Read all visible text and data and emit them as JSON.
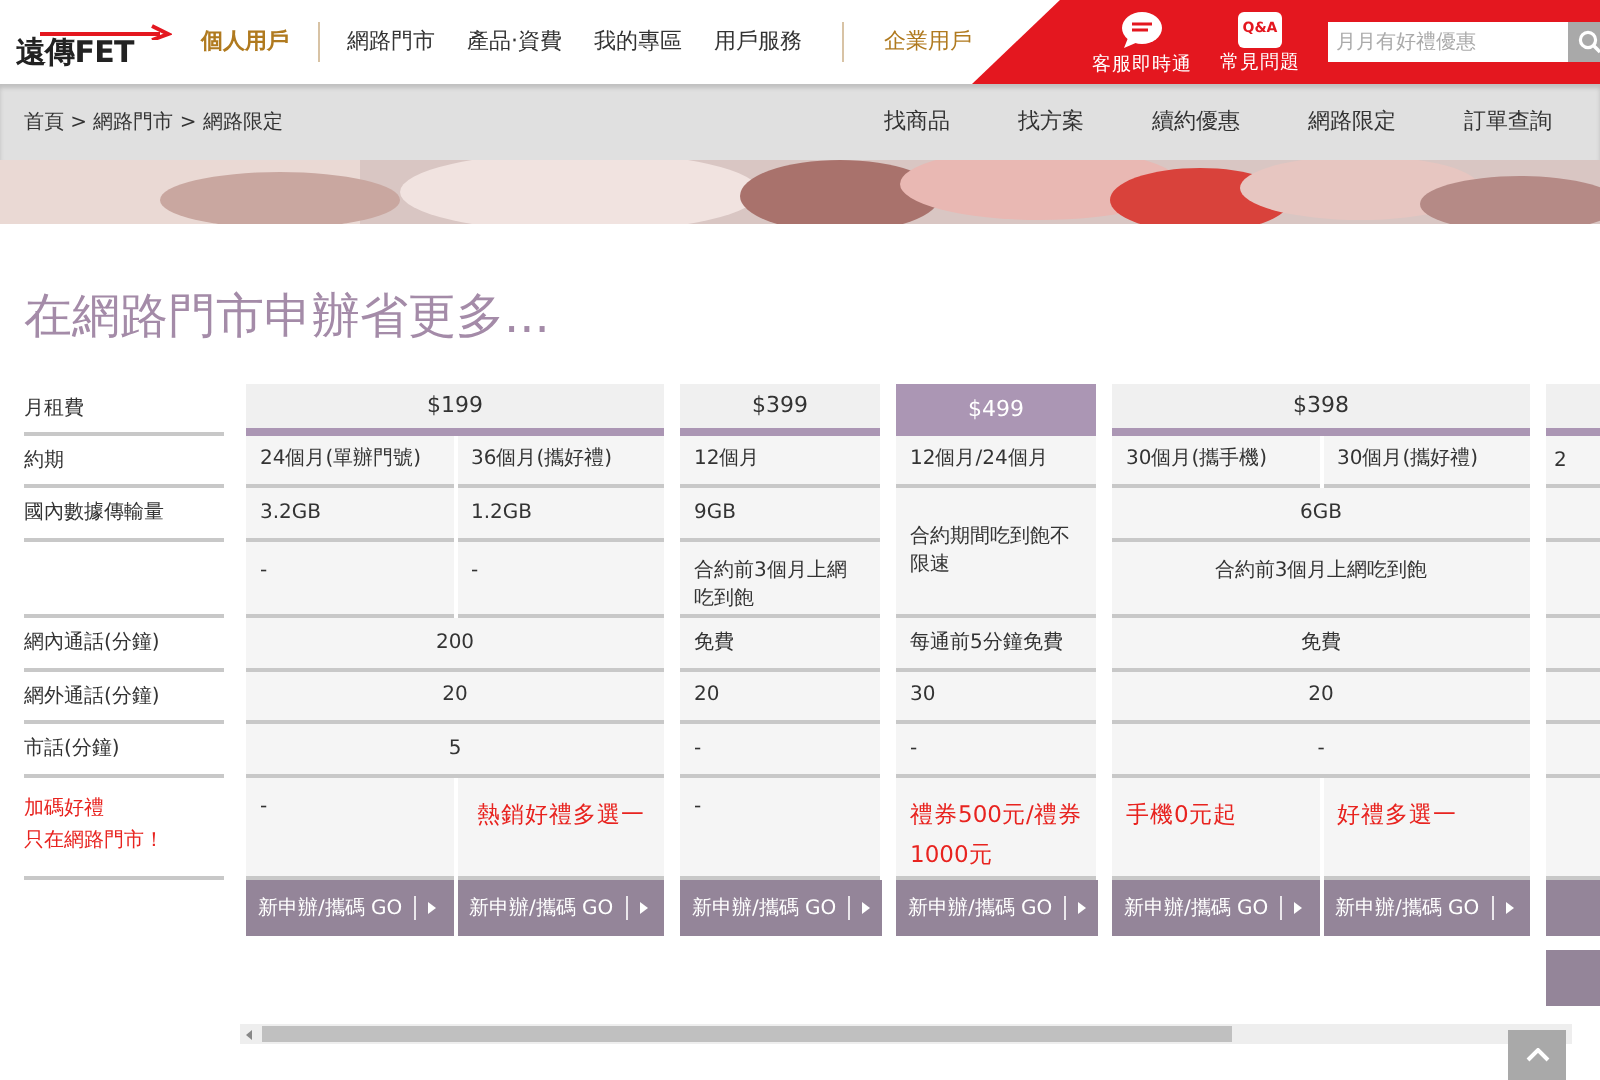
{
  "header": {
    "logo": "遠傳FET",
    "nav": [
      {
        "label": "個人用戶",
        "selected": true,
        "kind": "segment"
      },
      {
        "label": "網路門市",
        "selected": false,
        "kind": "link"
      },
      {
        "label": "產品‧資費",
        "selected": false,
        "kind": "link"
      },
      {
        "label": "我的專區",
        "selected": false,
        "kind": "link"
      },
      {
        "label": "用戶服務",
        "selected": false,
        "kind": "link"
      },
      {
        "label": "企業用戶",
        "selected": false,
        "kind": "segment"
      }
    ],
    "tools": [
      {
        "kind": "chat",
        "label": "客服即時通"
      },
      {
        "kind": "qa",
        "label": "常見問題",
        "badge": "Q&A"
      }
    ],
    "search": {
      "placeholder": "月月有好禮優惠"
    }
  },
  "breadcrumb": "首頁 > 網路門市 > 網路限定",
  "subnav": [
    "找商品",
    "找方案",
    "續約優惠",
    "網路限定",
    "訂單查詢"
  ],
  "banner": {
    "kind": "picture"
  },
  "heading": "在網路門市申辦省更多...",
  "row_labels": [
    {
      "kind": "text",
      "text": "月租費"
    },
    {
      "kind": "text",
      "text": "約期"
    },
    {
      "kind": "text",
      "text": "國內數據傳輸量"
    },
    {
      "kind": "blank"
    },
    {
      "kind": "text",
      "text": "網內通話(分鐘)"
    },
    {
      "kind": "text",
      "text": "網外通話(分鐘)"
    },
    {
      "kind": "text",
      "text": "市話(分鐘)"
    },
    {
      "kind": "promo",
      "lines": [
        "加碼好禮",
        "只在網路門市！"
      ]
    }
  ],
  "plans": [
    {
      "price": "$199",
      "selected": false,
      "rows": [
        {
          "kind": "plain",
          "cells": [
            "24個月(單辦門號)",
            "36個月(攜好禮)"
          ]
        },
        {
          "kind": "plain",
          "cells": [
            "3.2GB",
            "1.2GB"
          ]
        },
        {
          "kind": "plain",
          "cells": [
            "-",
            "-"
          ]
        },
        {
          "kind": "plain",
          "cells": [
            "200"
          ]
        },
        {
          "kind": "plain",
          "cells": [
            "20"
          ]
        },
        {
          "kind": "plain",
          "cells": [
            "5"
          ]
        },
        {
          "kind": "gift",
          "cells": [
            {
              "text": "-",
              "highlight": false
            },
            {
              "text": "熱銷好禮多選一",
              "highlight": true
            }
          ]
        },
        {
          "kind": "button",
          "cells": [
            "新申辦/攜碼 GO",
            "新申辦/攜碼 GO"
          ]
        }
      ]
    },
    {
      "price": "$399",
      "selected": false,
      "rows": [
        {
          "kind": "plain",
          "cells": [
            "12個月"
          ]
        },
        {
          "kind": "plain",
          "cells": [
            "9GB"
          ]
        },
        {
          "kind": "plain",
          "cells": [
            "合約前3個月上網吃到飽"
          ]
        },
        {
          "kind": "plain",
          "cells": [
            "免費"
          ]
        },
        {
          "kind": "plain",
          "cells": [
            "20"
          ]
        },
        {
          "kind": "plain",
          "cells": [
            "-"
          ]
        },
        {
          "kind": "gift",
          "cells": [
            {
              "text": "-",
              "highlight": false
            }
          ]
        },
        {
          "kind": "button",
          "cells": [
            "新申辦/攜碼 GO"
          ]
        }
      ]
    },
    {
      "price": "$499",
      "selected": true,
      "rows": [
        {
          "kind": "plain",
          "cells": [
            "12個月/24個月"
          ]
        },
        {
          "kind": "plain",
          "spans_next": true,
          "cells": [
            "合約期間吃到飽不限速"
          ]
        },
        {
          "kind": "plain",
          "cells": [
            "每通前5分鐘免費"
          ]
        },
        {
          "kind": "plain",
          "cells": [
            "30"
          ]
        },
        {
          "kind": "plain",
          "cells": [
            "-"
          ]
        },
        {
          "kind": "gift",
          "cells": [
            {
              "text": "禮券500元/禮券1000元",
              "highlight": true
            }
          ]
        },
        {
          "kind": "button",
          "cells": [
            "新申辦/攜碼 GO"
          ]
        }
      ]
    },
    {
      "price": "$398",
      "selected": false,
      "rows": [
        {
          "kind": "plain",
          "cells": [
            "30個月(攜手機)",
            "30個月(攜好禮)"
          ]
        },
        {
          "kind": "plain",
          "cells": [
            "6GB"
          ]
        },
        {
          "kind": "plain",
          "cells": [
            "合約前3個月上網吃到飽"
          ]
        },
        {
          "kind": "plain",
          "cells": [
            "免費"
          ]
        },
        {
          "kind": "plain",
          "cells": [
            "20"
          ]
        },
        {
          "kind": "plain",
          "cells": [
            "-"
          ]
        },
        {
          "kind": "gift",
          "cells": [
            {
              "text": "手機0元起",
              "highlight": true
            },
            {
              "text": "好禮多選一",
              "highlight": true
            }
          ]
        },
        {
          "kind": "button",
          "cells": [
            "新申辦/攜碼 GO",
            "新申辦/攜碼 GO"
          ]
        }
      ]
    }
  ],
  "cut_column": {
    "contract": "2"
  }
}
